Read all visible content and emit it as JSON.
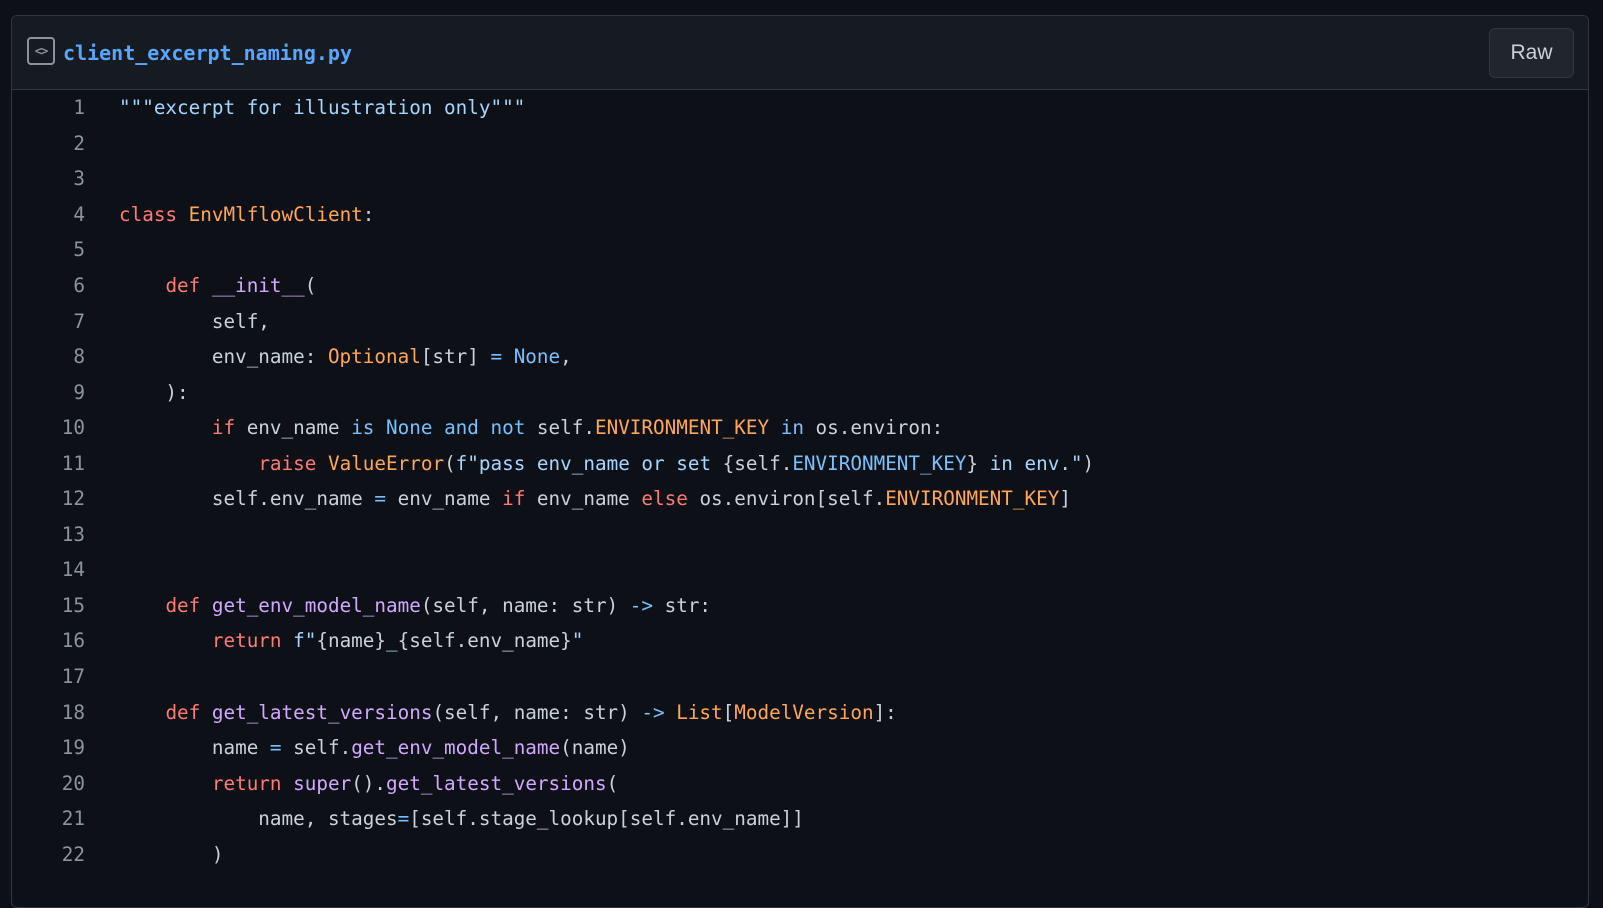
{
  "header": {
    "file_name": "client_excerpt_naming.py",
    "file_icon": "code-square-icon",
    "raw_label": "Raw"
  },
  "colors": {
    "background": "#0d1117",
    "header_background": "#161b22",
    "link": "#58a6ff",
    "string": "#a5d6ff",
    "keyword": "#ff7b72",
    "class_name": "#ffa657",
    "function": "#d2a8ff",
    "constant": "#79c0ff",
    "text": "#c9d1d9",
    "line_number": "#8b949e"
  },
  "code": {
    "lines": [
      {
        "num": "1",
        "tokens": [
          {
            "t": "\"\"\"excerpt for illustration only\"\"\"",
            "c": "str"
          }
        ]
      },
      {
        "num": "2",
        "tokens": []
      },
      {
        "num": "3",
        "tokens": []
      },
      {
        "num": "4",
        "tokens": [
          {
            "t": "class ",
            "c": "kw"
          },
          {
            "t": "EnvMlflowClient",
            "c": "cls"
          },
          {
            "t": ":",
            "c": "txt"
          }
        ]
      },
      {
        "num": "5",
        "tokens": []
      },
      {
        "num": "6",
        "tokens": [
          {
            "t": "    ",
            "c": "txt"
          },
          {
            "t": "def ",
            "c": "kw"
          },
          {
            "t": "__init__",
            "c": "fn"
          },
          {
            "t": "(",
            "c": "txt"
          }
        ]
      },
      {
        "num": "7",
        "tokens": [
          {
            "t": "        self,",
            "c": "txt"
          }
        ]
      },
      {
        "num": "8",
        "tokens": [
          {
            "t": "        env_name: ",
            "c": "txt"
          },
          {
            "t": "Optional",
            "c": "cls"
          },
          {
            "t": "[str] ",
            "c": "txt"
          },
          {
            "t": "=",
            "c": "con"
          },
          {
            "t": " ",
            "c": "txt"
          },
          {
            "t": "None",
            "c": "con"
          },
          {
            "t": ",",
            "c": "txt"
          }
        ]
      },
      {
        "num": "9",
        "tokens": [
          {
            "t": "    ):",
            "c": "txt"
          }
        ]
      },
      {
        "num": "10",
        "tokens": [
          {
            "t": "        ",
            "c": "txt"
          },
          {
            "t": "if",
            "c": "kw"
          },
          {
            "t": " env_name ",
            "c": "txt"
          },
          {
            "t": "is",
            "c": "con"
          },
          {
            "t": " ",
            "c": "txt"
          },
          {
            "t": "None",
            "c": "con"
          },
          {
            "t": " ",
            "c": "txt"
          },
          {
            "t": "and",
            "c": "con"
          },
          {
            "t": " ",
            "c": "txt"
          },
          {
            "t": "not",
            "c": "con"
          },
          {
            "t": " self.",
            "c": "txt"
          },
          {
            "t": "ENVIRONMENT_KEY",
            "c": "cls"
          },
          {
            "t": " ",
            "c": "txt"
          },
          {
            "t": "in",
            "c": "con"
          },
          {
            "t": " os.environ:",
            "c": "txt"
          }
        ]
      },
      {
        "num": "11",
        "tokens": [
          {
            "t": "            ",
            "c": "txt"
          },
          {
            "t": "raise",
            "c": "kw"
          },
          {
            "t": " ",
            "c": "txt"
          },
          {
            "t": "ValueError",
            "c": "cls"
          },
          {
            "t": "(",
            "c": "txt"
          },
          {
            "t": "f\"pass env_name or set ",
            "c": "str"
          },
          {
            "t": "{self.",
            "c": "txt"
          },
          {
            "t": "ENVIRONMENT_KEY",
            "c": "con"
          },
          {
            "t": "}",
            "c": "txt"
          },
          {
            "t": " in env.\"",
            "c": "str"
          },
          {
            "t": ")",
            "c": "txt"
          }
        ]
      },
      {
        "num": "12",
        "tokens": [
          {
            "t": "        self.env_name ",
            "c": "txt"
          },
          {
            "t": "=",
            "c": "con"
          },
          {
            "t": " env_name ",
            "c": "txt"
          },
          {
            "t": "if",
            "c": "kw"
          },
          {
            "t": " env_name ",
            "c": "txt"
          },
          {
            "t": "else",
            "c": "kw"
          },
          {
            "t": " os.environ[self.",
            "c": "txt"
          },
          {
            "t": "ENVIRONMENT_KEY",
            "c": "cls"
          },
          {
            "t": "]",
            "c": "txt"
          }
        ]
      },
      {
        "num": "13",
        "tokens": []
      },
      {
        "num": "14",
        "tokens": []
      },
      {
        "num": "15",
        "tokens": [
          {
            "t": "    ",
            "c": "txt"
          },
          {
            "t": "def ",
            "c": "kw"
          },
          {
            "t": "get_env_model_name",
            "c": "fn"
          },
          {
            "t": "(self, name: str) ",
            "c": "txt"
          },
          {
            "t": "->",
            "c": "con"
          },
          {
            "t": " str:",
            "c": "txt"
          }
        ]
      },
      {
        "num": "16",
        "tokens": [
          {
            "t": "        ",
            "c": "txt"
          },
          {
            "t": "return",
            "c": "kw"
          },
          {
            "t": " ",
            "c": "txt"
          },
          {
            "t": "f\"",
            "c": "str"
          },
          {
            "t": "{name}",
            "c": "txt"
          },
          {
            "t": "_",
            "c": "str"
          },
          {
            "t": "{self.env_name}",
            "c": "txt"
          },
          {
            "t": "\"",
            "c": "str"
          }
        ]
      },
      {
        "num": "17",
        "tokens": []
      },
      {
        "num": "18",
        "tokens": [
          {
            "t": "    ",
            "c": "txt"
          },
          {
            "t": "def ",
            "c": "kw"
          },
          {
            "t": "get_latest_versions",
            "c": "fn"
          },
          {
            "t": "(self, name: str) ",
            "c": "txt"
          },
          {
            "t": "->",
            "c": "con"
          },
          {
            "t": " ",
            "c": "txt"
          },
          {
            "t": "List",
            "c": "cls"
          },
          {
            "t": "[",
            "c": "txt"
          },
          {
            "t": "ModelVersion",
            "c": "cls"
          },
          {
            "t": "]:",
            "c": "txt"
          }
        ]
      },
      {
        "num": "19",
        "tokens": [
          {
            "t": "        name ",
            "c": "txt"
          },
          {
            "t": "=",
            "c": "con"
          },
          {
            "t": " self.",
            "c": "txt"
          },
          {
            "t": "get_env_model_name",
            "c": "fn"
          },
          {
            "t": "(name)",
            "c": "txt"
          }
        ]
      },
      {
        "num": "20",
        "tokens": [
          {
            "t": "        ",
            "c": "txt"
          },
          {
            "t": "return",
            "c": "kw"
          },
          {
            "t": " ",
            "c": "txt"
          },
          {
            "t": "super",
            "c": "fn"
          },
          {
            "t": "().",
            "c": "txt"
          },
          {
            "t": "get_latest_versions",
            "c": "fn"
          },
          {
            "t": "(",
            "c": "txt"
          }
        ]
      },
      {
        "num": "21",
        "tokens": [
          {
            "t": "            name, stages",
            "c": "txt"
          },
          {
            "t": "=",
            "c": "con"
          },
          {
            "t": "[self.stage_lookup[self.env_name]]",
            "c": "txt"
          }
        ]
      },
      {
        "num": "22",
        "tokens": [
          {
            "t": "        )",
            "c": "txt"
          }
        ]
      }
    ]
  }
}
